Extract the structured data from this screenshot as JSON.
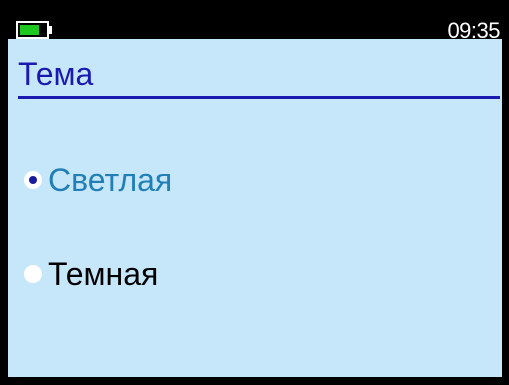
{
  "status_bar": {
    "battery_icon": "battery-icon",
    "time": "09:35"
  },
  "page": {
    "title": "Тема"
  },
  "options": [
    {
      "label": "Светлая",
      "selected": true
    },
    {
      "label": "Темная",
      "selected": false
    }
  ],
  "colors": {
    "background": "#c6e6fa",
    "frame": "#000000",
    "title": "#1a1ab0",
    "selected_label": "#1f7fb6",
    "battery": "#1ec81e"
  }
}
